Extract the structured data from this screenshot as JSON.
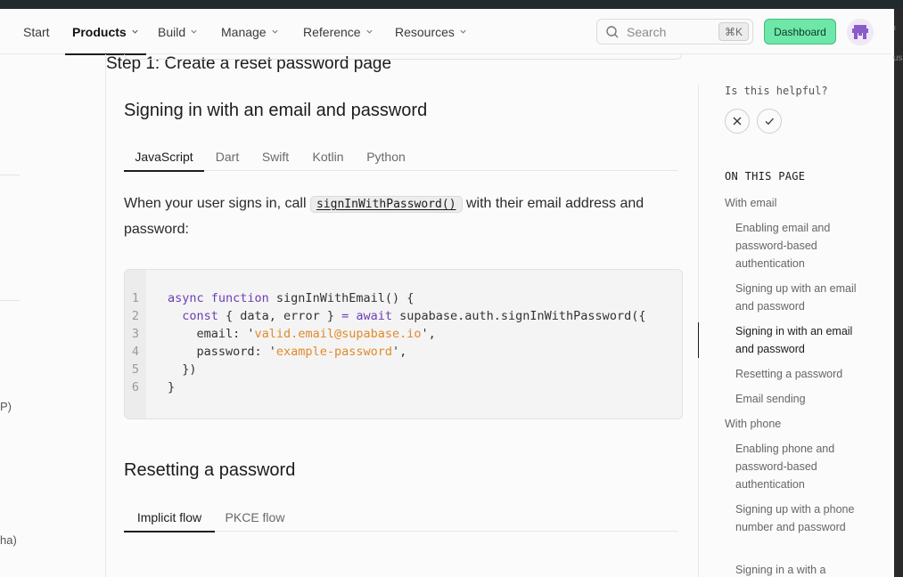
{
  "nav": {
    "items": [
      {
        "label": "Start"
      },
      {
        "label": "Products"
      },
      {
        "label": "Build"
      },
      {
        "label": "Manage"
      },
      {
        "label": "Reference"
      },
      {
        "label": "Resources"
      }
    ],
    "active": "Products",
    "search_placeholder": "Search",
    "search_shortcut": "⌘K",
    "dashboard_label": "Dashboard"
  },
  "left_fragments": [
    "P)",
    "ha)"
  ],
  "edge_fragment": "us",
  "main": {
    "section1": {
      "title": "Signing in with an email and password",
      "tabs": [
        "JavaScript",
        "Dart",
        "Swift",
        "Kotlin",
        "Python"
      ],
      "active_tab": "JavaScript",
      "para_before": "When your user signs in, call ",
      "para_code": "signInWithPassword()",
      "para_after": " with their email address and password:",
      "code": {
        "line_numbers": [
          "1",
          "2",
          "3",
          "4",
          "5",
          "6"
        ],
        "lines": [
          [
            {
              "t": "async function",
              "c": "kw"
            },
            {
              "t": " signInWithEmail() {",
              "c": "fn"
            }
          ],
          [
            {
              "t": "  ",
              "c": "fn"
            },
            {
              "t": "const",
              "c": "kw"
            },
            {
              "t": " { data, error } ",
              "c": "fn"
            },
            {
              "t": "= await",
              "c": "kw"
            },
            {
              "t": " supabase.auth.signInWithPassword({",
              "c": "fn"
            }
          ],
          [
            {
              "t": "    email: '",
              "c": "fn"
            },
            {
              "t": "valid.email@supabase.io",
              "c": "str"
            },
            {
              "t": "',",
              "c": "fn"
            }
          ],
          [
            {
              "t": "    password: '",
              "c": "fn"
            },
            {
              "t": "example-password",
              "c": "str"
            },
            {
              "t": "',",
              "c": "fn"
            }
          ],
          [
            {
              "t": "  })",
              "c": "fn"
            }
          ],
          [
            {
              "t": "}",
              "c": "fn"
            }
          ]
        ]
      }
    },
    "section2": {
      "title": "Resetting a password",
      "tabs": [
        "Implicit flow",
        "PKCE flow"
      ],
      "active_tab": "Implicit flow",
      "next_heading": "Step 1: Create a reset password page"
    }
  },
  "toc": {
    "helpful_label": "Is this helpful?",
    "heading": "ON THIS PAGE",
    "items": [
      {
        "label": "With email",
        "level": 1
      },
      {
        "label": "Enabling email and password-based authentication",
        "level": 2
      },
      {
        "label": "Signing up with an email and password",
        "level": 2
      },
      {
        "label": "Signing in with an email and password",
        "level": 2,
        "active": true
      },
      {
        "label": "Resetting a password",
        "level": 2
      },
      {
        "label": "Email sending",
        "level": 2
      },
      {
        "label": "With phone",
        "level": 1
      },
      {
        "label": "Enabling phone and password-based authentication",
        "level": 2
      },
      {
        "label": "Signing up with a phone number and password",
        "level": 2
      },
      {
        "label": "Signing in a with a",
        "level": 2
      }
    ]
  },
  "colors": {
    "accent_green": "#6ee7a8",
    "keyword_purple": "#6b3fb6",
    "string_orange": "#e08a2b"
  }
}
